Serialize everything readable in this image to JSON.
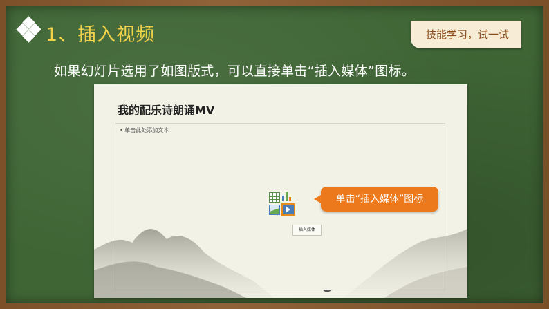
{
  "title": "1、插入视频",
  "tag": "技能学习，试一试",
  "instruction": "如果幻灯片选用了如图版式，可以直接单击“插入媒体”图标。",
  "slide": {
    "title": "我的配乐诗朗诵MV",
    "placeholder_text": "•  单击此处添加文本",
    "insert_button": "插入媒体",
    "callout": "单击“插入媒体”图标",
    "icons": [
      "table-icon",
      "chart-icon",
      "picture-icon",
      "media-icon"
    ]
  },
  "colors": {
    "board": "#3f6535",
    "frame": "#8a5a2e",
    "title": "#f3d34a",
    "callout": "#ec7a1d",
    "tag_bg": "#f7ecd6"
  }
}
